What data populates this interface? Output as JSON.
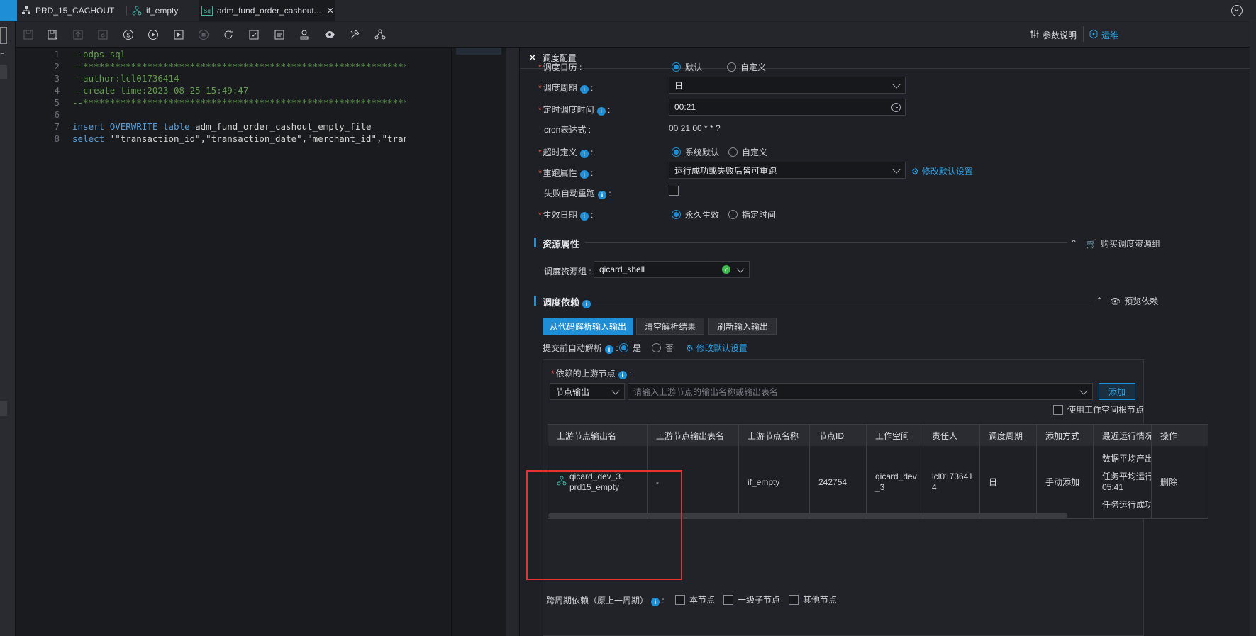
{
  "tabs": [
    {
      "label": "PRD_15_CACHOUT",
      "icon": "network-icon"
    },
    {
      "label": "if_empty",
      "icon": "branch-icon"
    },
    {
      "label": "adm_fund_order_cashout...",
      "icon": "sql-icon",
      "active": true
    }
  ],
  "toolbar": {
    "param_help": "参数说明",
    "ops_short": "运维"
  },
  "editor": {
    "lines": [
      {
        "no": "1",
        "text": "--odps sql",
        "kind": "comment"
      },
      {
        "no": "2",
        "text": "--********************************************************************",
        "kind": "comment"
      },
      {
        "no": "3",
        "text": "--author:lcl01736414",
        "kind": "comment"
      },
      {
        "no": "4",
        "text": "--create time:2023-08-25 15:49:47",
        "kind": "comment"
      },
      {
        "no": "5",
        "text": "--********************************************************************",
        "kind": "comment"
      },
      {
        "no": "6",
        "text": "",
        "kind": "blank"
      },
      {
        "no": "7",
        "kw1": "insert",
        "kw2": "OVERWRITE",
        "kw3": "table",
        "rest": " adm_fund_order_cashout_empty_file",
        "kind": "insert"
      },
      {
        "no": "8",
        "kw1": "select",
        "rest": " '\"transaction_id\",\"transaction_date\",\"merchant_id\",\"transaction",
        "kind": "select"
      }
    ]
  },
  "panel": {
    "title": "调度配置",
    "schedule_date": {
      "label": "调度日历",
      "opt_default": "默认",
      "opt_custom": "自定义"
    },
    "cycle": {
      "label": "调度周期",
      "value": "日"
    },
    "timed": {
      "label": "定时调度时间",
      "value": "00:21"
    },
    "cron": {
      "label": "cron表达式",
      "value": "00 21 00 * * ?"
    },
    "timeout": {
      "label": "超时定义",
      "opt_default": "系统默认",
      "opt_custom": "自定义"
    },
    "rerun": {
      "label": "重跑属性",
      "value": "运行成功或失败后皆可重跑",
      "link": "修改默认设置"
    },
    "auto_rerun": {
      "label": "失败自动重跑"
    },
    "effective": {
      "label": "生效日期",
      "opt_forever": "永久生效",
      "opt_specify": "指定时间"
    },
    "resource": {
      "title": "资源属性",
      "buy": "购买调度资源组",
      "group_label": "调度资源组",
      "group_value": "qicard_shell"
    },
    "deps": {
      "title": "调度依赖",
      "preview": "预览依赖",
      "btn_parse": "从代码解析输入输出",
      "btn_clear": "清空解析结果",
      "btn_refresh": "刷新输入输出",
      "auto_parse_label": "提交前自动解析",
      "opt_yes": "是",
      "opt_no": "否",
      "modify_link": "修改默认设置",
      "upstream_label": "依赖的上游节点",
      "select_value": "节点输出",
      "search_placeholder": "请输入上游节点的输出名称或输出表名",
      "add": "添加",
      "use_root": "使用工作空间根节点",
      "columns": [
        "上游节点输出名",
        "上游节点输出表名",
        "上游节点名称",
        "节点ID",
        "工作空间",
        "责任人",
        "调度周期",
        "添加方式",
        "最近运行情况",
        "操作"
      ],
      "row": {
        "output_name": "qicard_dev_3.prd15_empty",
        "output_table": "-",
        "node_name": "if_empty",
        "node_id": "242754",
        "workspace": "qicard_dev_3",
        "owner": "lcl01736414",
        "cycle": "日",
        "add_mode": "手动添加",
        "recent1": "数据平均产出",
        "recent2": "任务平均运行",
        "recent3": "05:41",
        "recent4": "任务运行成功",
        "action": "删除"
      },
      "cross_label": "跨周期依赖（原上一周期）",
      "cross_self": "本节点",
      "cross_child": "一级子节点",
      "cross_other": "其他节点"
    }
  },
  "colors": {
    "accent": "#1e8fd6",
    "highlight_box": "#e53333"
  }
}
